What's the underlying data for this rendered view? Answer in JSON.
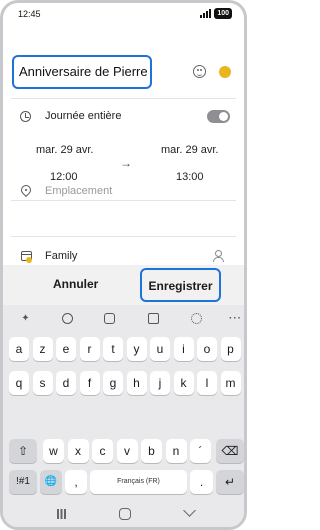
{
  "status_bar": {
    "time": "12:45",
    "battery": "100"
  },
  "event": {
    "title": "Anniversaire de Pierre",
    "all_day_label": "Journée entière",
    "all_day_enabled": false,
    "start_date": "mar. 29 avr.",
    "start_time": "12:00",
    "end_date": "mar. 29 avr.",
    "end_time": "13:00",
    "arrow": "→",
    "location_placeholder": "Emplacement",
    "calendar_name": "Family",
    "calendar_color": "#e8b51f"
  },
  "actions": {
    "cancel_label": "Annuler",
    "save_label": "Enregistrer"
  },
  "keyboard": {
    "toolbar_icons": [
      "sparkle-icon",
      "emoji-icon",
      "sticker-icon",
      "clipboard-icon",
      "gear-icon",
      "more-icon"
    ],
    "more_label": "···",
    "row1": [
      "a",
      "z",
      "e",
      "r",
      "t",
      "y",
      "u",
      "i",
      "o",
      "p"
    ],
    "row2": [
      "q",
      "s",
      "d",
      "f",
      "g",
      "h",
      "j",
      "k",
      "l",
      "m"
    ],
    "row3": [
      "w",
      "x",
      "c",
      "v",
      "b",
      "n",
      "´"
    ],
    "shift_label": "⇧",
    "backspace_label": "⌫",
    "symbols_label": "!#1",
    "globe_label": "🌐",
    "comma_label": ",",
    "space_label": "Français (FR)",
    "period_label": ".",
    "enter_label": "↵"
  }
}
